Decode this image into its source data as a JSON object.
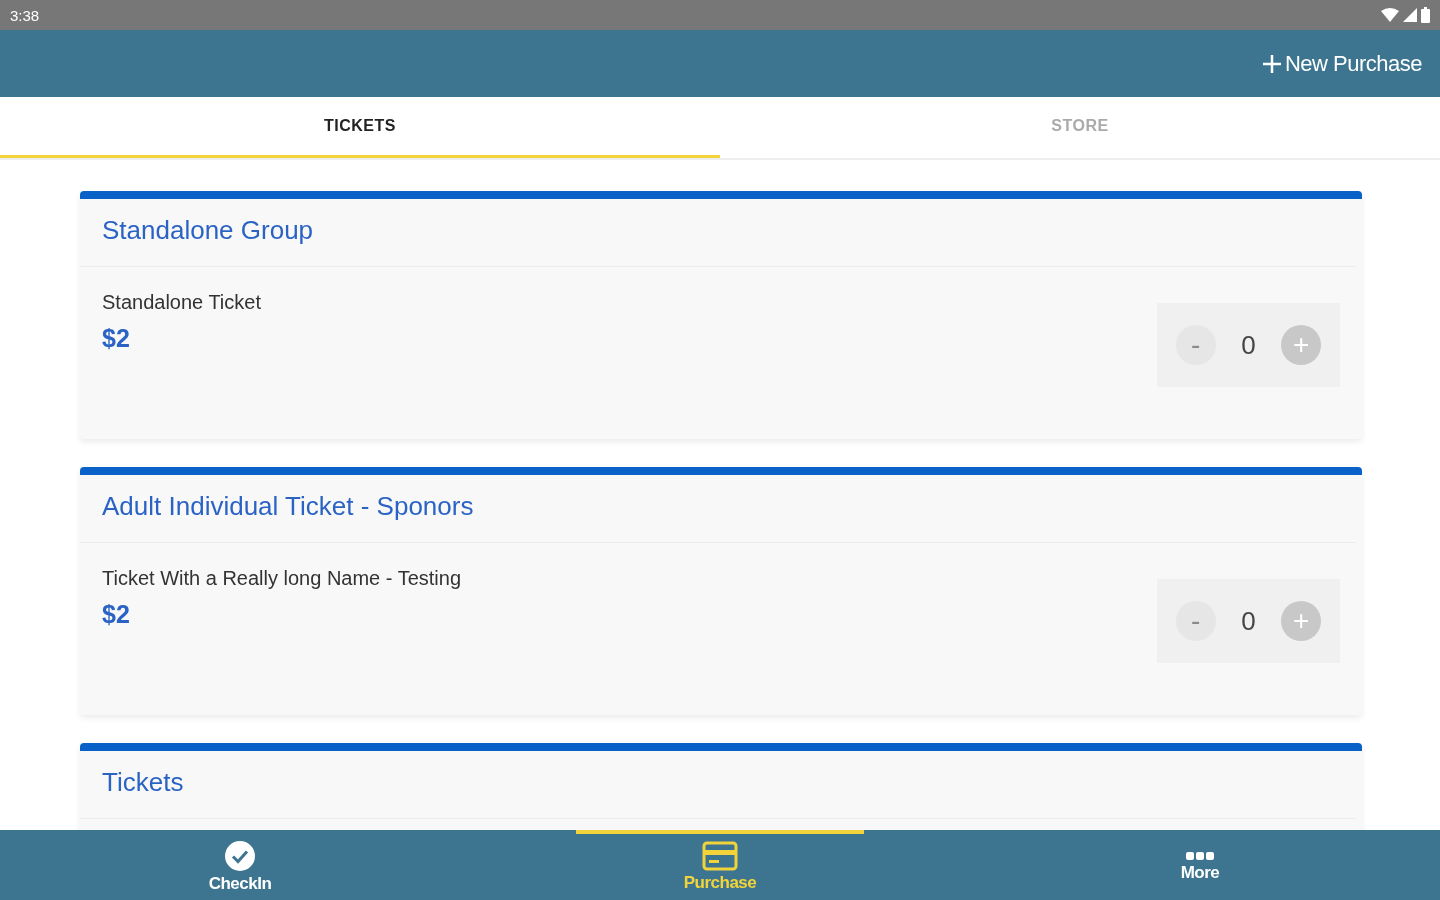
{
  "status_bar": {
    "time": "3:38"
  },
  "app_bar": {
    "action": "New Purchase"
  },
  "tabs": [
    {
      "label": "TICKETS",
      "selected": true
    },
    {
      "label": "STORE",
      "selected": false
    }
  ],
  "groups": [
    {
      "title": "Standalone Group",
      "items": [
        {
          "name": "Standalone Ticket",
          "price": "$2",
          "stepper": {
            "minus": "-",
            "value": "0",
            "plus": "+",
            "minus_disabled": true
          }
        }
      ]
    },
    {
      "title": "Adult Individual Ticket - Sponors",
      "items": [
        {
          "name": "Ticket With a Really long Name - Testing",
          "price": "$2",
          "stepper": {
            "minus": "-",
            "value": "0",
            "plus": "+",
            "minus_disabled": true
          }
        }
      ]
    },
    {
      "title": "Tickets"
    }
  ],
  "bottom_nav": [
    {
      "label": "CheckIn",
      "kind": "check",
      "selected": false
    },
    {
      "label": "Purchase",
      "kind": "card",
      "selected": true
    },
    {
      "label": "More",
      "kind": "dots",
      "selected": false
    }
  ]
}
